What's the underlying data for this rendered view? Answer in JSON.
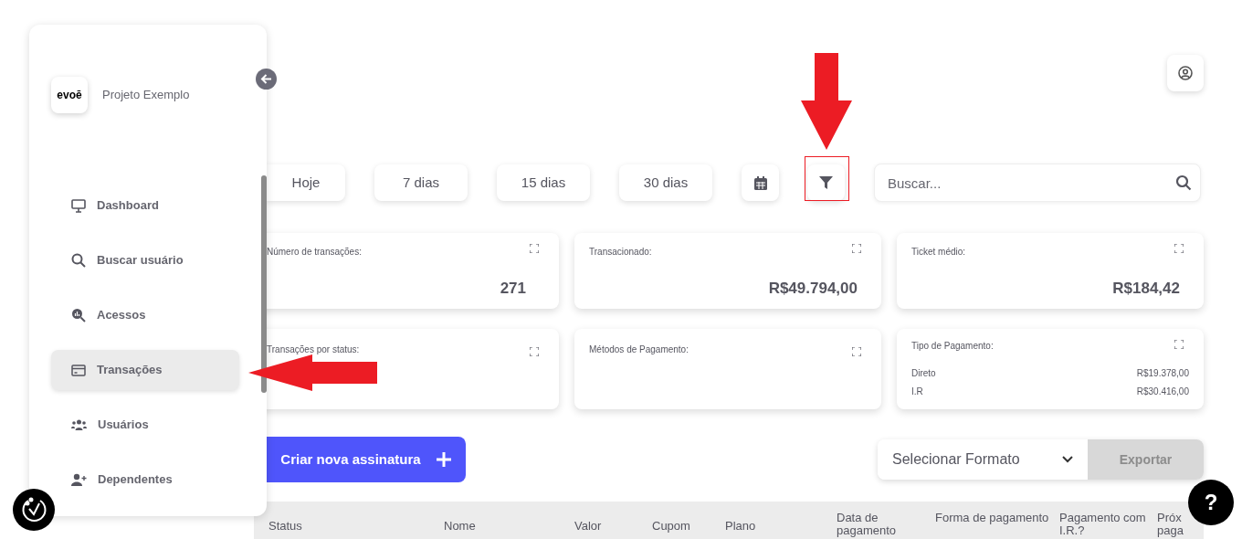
{
  "sidebar": {
    "logo": "evoē",
    "project": "Projeto Exemplo",
    "items": [
      {
        "label": "Dashboard",
        "selected": false
      },
      {
        "label": "Buscar usuário",
        "selected": false
      },
      {
        "label": "Acessos",
        "selected": false
      },
      {
        "label": "Transações",
        "selected": true
      },
      {
        "label": "Usuários",
        "selected": false
      },
      {
        "label": "Dependentes",
        "selected": false
      }
    ]
  },
  "period_buttons": [
    "Hoje",
    "7 dias",
    "15 dias",
    "30 dias"
  ],
  "search": {
    "placeholder": "Buscar..."
  },
  "cards": [
    {
      "kind": "value",
      "title": "Número de transações:",
      "value": "271"
    },
    {
      "kind": "value",
      "title": "Transacionado:",
      "value": "R$49.794,00"
    },
    {
      "kind": "value",
      "title": "Ticket médio:",
      "value": "R$184,42"
    },
    {
      "kind": "empty",
      "title": "Transações por status:"
    },
    {
      "kind": "empty",
      "title": "Métodos de Pagamento:"
    },
    {
      "kind": "list",
      "title": "Tipo de Pagamento:",
      "rows": [
        {
          "label": "Direto",
          "value": "R$19.378,00"
        },
        {
          "label": "I.R",
          "value": "R$30.416,00"
        }
      ]
    }
  ],
  "create_button": "Criar nova assinatura",
  "format_select": "Selecionar Formato",
  "export_button": {
    "label": "Exportar",
    "disabled": true
  },
  "table": {
    "columns": [
      "Status",
      "Nome",
      "Valor",
      "Cupom",
      "Plano",
      "Data de pagamento",
      "Forma de pagamento",
      "Pagamento com I.R.?",
      "Próx paga"
    ]
  },
  "help_button": "?"
}
